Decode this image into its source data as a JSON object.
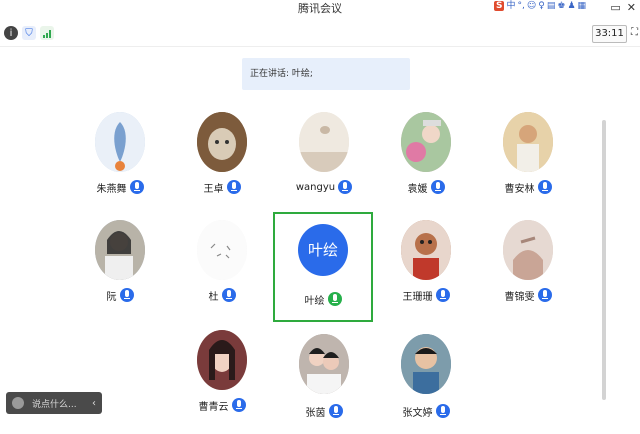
{
  "window": {
    "title": "腾讯会议"
  },
  "ime_bar": {
    "items": [
      "S",
      "中",
      "°,",
      "☺",
      "♀",
      "▤",
      "♚",
      "♟",
      "▦"
    ]
  },
  "window_controls": [
    "▭",
    "✕"
  ],
  "toolbar": {
    "timer": "33:11"
  },
  "speaking": {
    "text": "正在讲话: 叶绘;"
  },
  "participants": [
    {
      "name": "朱燕舞",
      "mic": "blue",
      "avatar_color": "#b9cfe6"
    },
    {
      "name": "王卓",
      "mic": "blue",
      "avatar_color": "#8b6c4a"
    },
    {
      "name": "wangyu",
      "mic": "blue",
      "avatar_color": "#e8e2d8"
    },
    {
      "name": "袁媛",
      "mic": "blue",
      "avatar_color": "#c8a2b0"
    },
    {
      "name": "曹安林",
      "mic": "blue",
      "avatar_color": "#d7b98a"
    },
    {
      "name": "阮",
      "mic": "blue",
      "avatar_color": "#9aa7b8"
    },
    {
      "name": "杜",
      "mic": "blue",
      "avatar_color": "#f5f5f5"
    },
    {
      "name": "叶绘",
      "mic": "green",
      "avatar_text": "叶绘"
    },
    {
      "name": "王珊珊",
      "mic": "blue",
      "avatar_color": "#b7866c"
    },
    {
      "name": "曹锦雯",
      "mic": "blue",
      "avatar_color": "#d9c6bf"
    },
    {
      "name": "曹青云",
      "mic": "blue",
      "avatar_color": "#c3a79a"
    },
    {
      "name": "张茵",
      "mic": "blue",
      "avatar_color": "#a8a19c"
    },
    {
      "name": "张文婷",
      "mic": "blue",
      "avatar_color": "#6e8fa1"
    }
  ],
  "chat": {
    "placeholder": "说点什么...",
    "arrow": "‹"
  }
}
